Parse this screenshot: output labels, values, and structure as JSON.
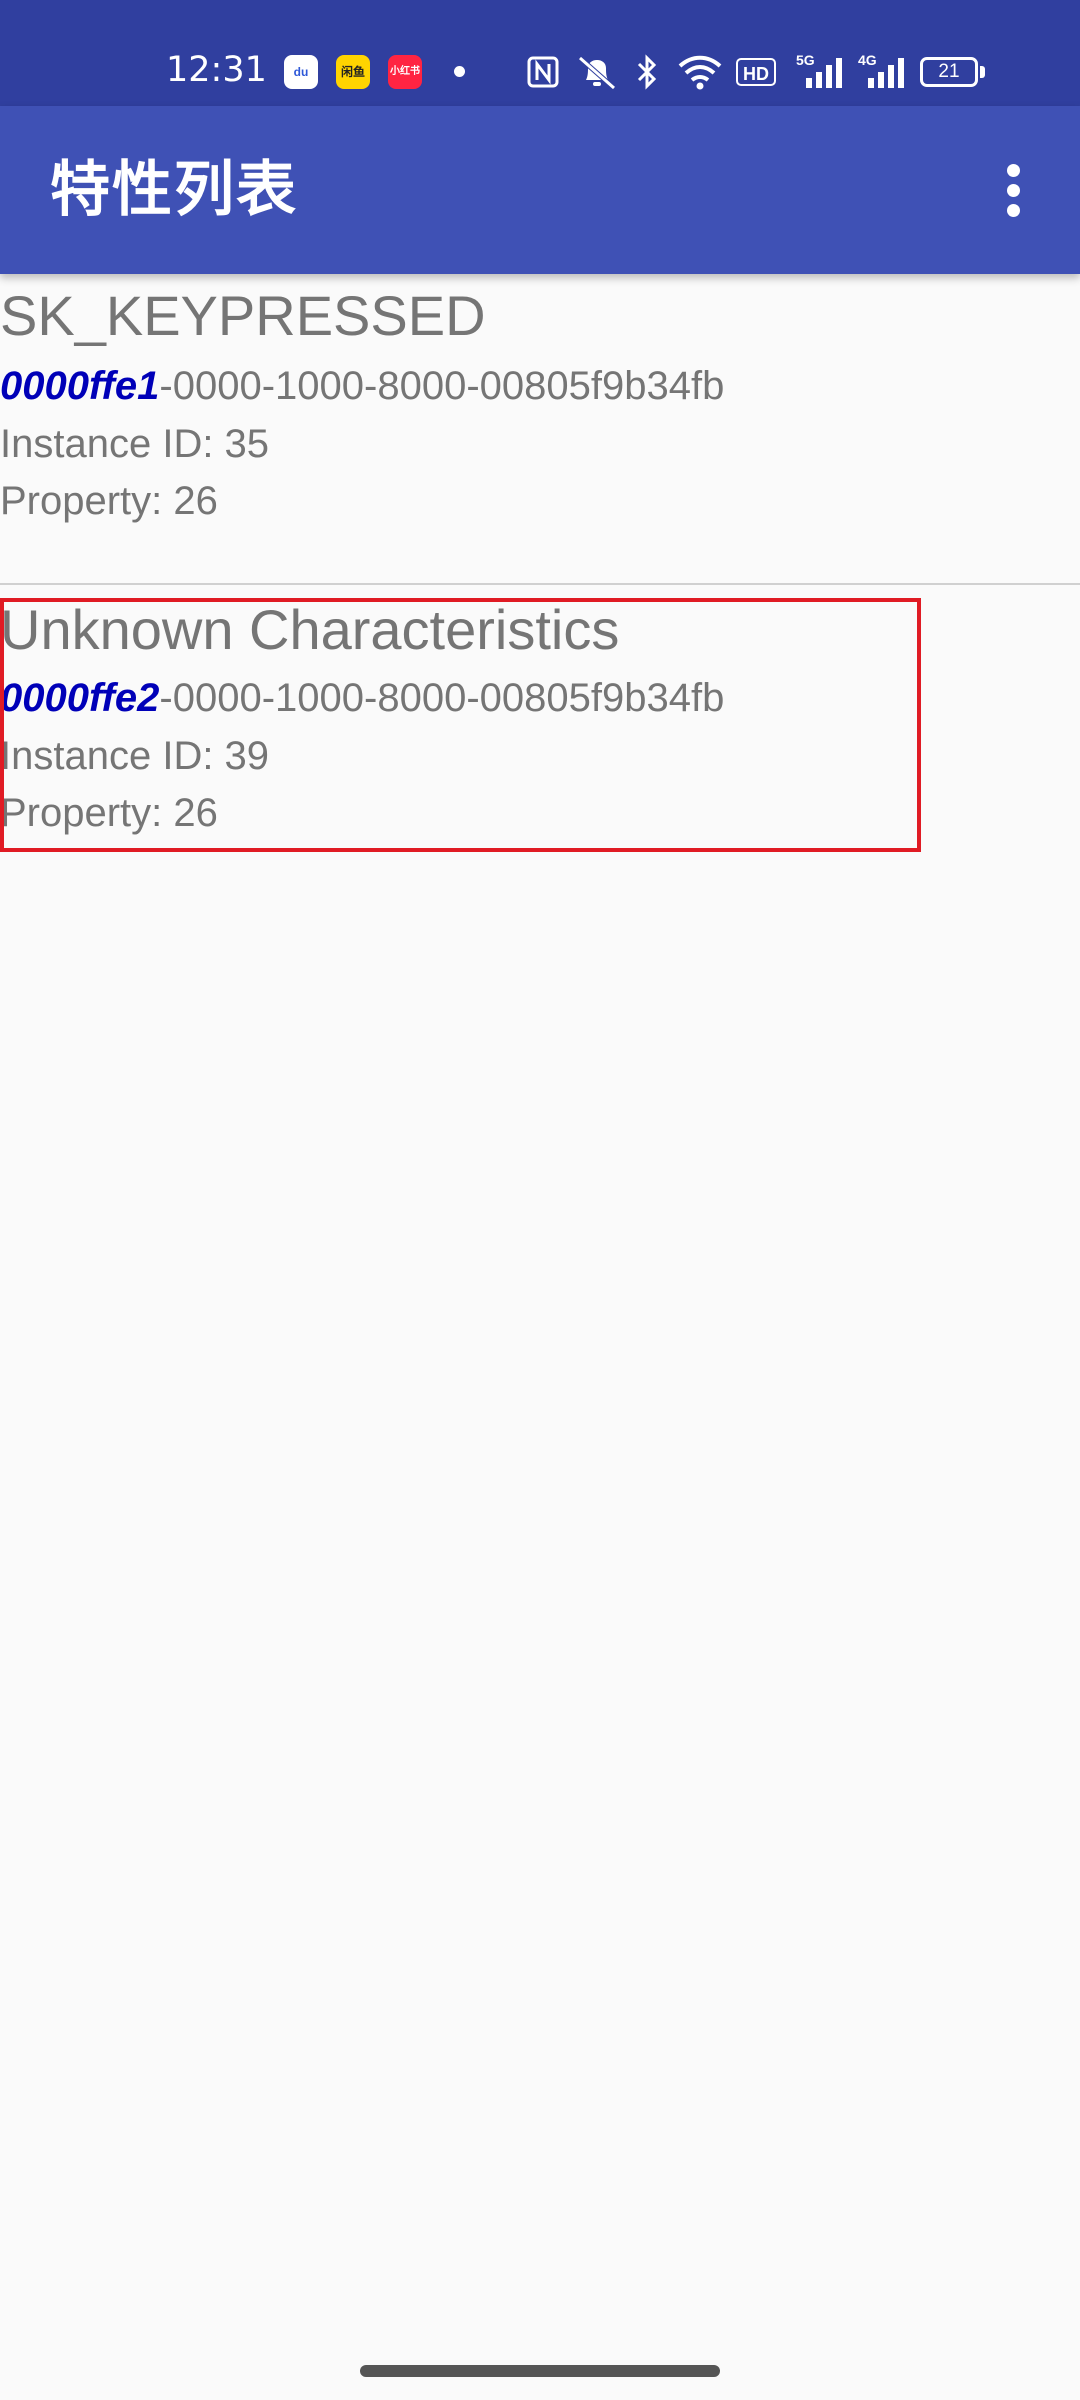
{
  "status_bar": {
    "time": "12:31",
    "notification_apps": [
      "baidu-app-icon",
      "xianyu-app-icon",
      "xiaohongshu-app-icon"
    ],
    "app_badge_labels": {
      "baidu": "du",
      "xianyu": "闲鱼",
      "xiaohongshu": "小红书"
    },
    "hd_label": "HD",
    "network_5g": "5G",
    "network_4g": "4G",
    "battery_level": "21"
  },
  "app_bar": {
    "title": "特性列表",
    "menu_icon": "more-vert-icon"
  },
  "characteristics": [
    {
      "name": "SK_KEYPRESSED",
      "uuid_short": "0000ffe1",
      "uuid_rest": "-0000-1000-8000-00805f9b34fb",
      "instance_id": "Instance ID: 35",
      "property": "Property: 26"
    },
    {
      "name": "Unknown Characteristics",
      "uuid_short": "0000ffe2",
      "uuid_rest": "-0000-1000-8000-00805f9b34fb",
      "instance_id": "Instance ID: 39",
      "property": "Property: 26"
    }
  ],
  "colors": {
    "status_bar": "#303f9f",
    "app_bar": "#3f51b5",
    "uuid_highlight": "#0000b8",
    "text_secondary": "#757575",
    "selection_outline": "#e01b24",
    "background": "#fafafa"
  }
}
